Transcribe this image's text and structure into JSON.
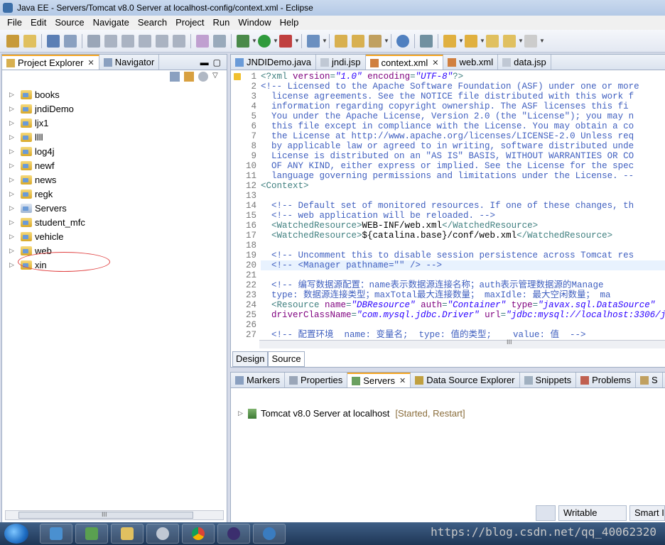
{
  "window": {
    "title": "Java EE - Servers/Tomcat v8.0 Server at localhost-config/context.xml - Eclipse"
  },
  "menu": [
    "File",
    "Edit",
    "Source",
    "Navigate",
    "Search",
    "Project",
    "Run",
    "Window",
    "Help"
  ],
  "left_panel": {
    "tabs": [
      {
        "label": "Project Explorer",
        "active": true,
        "closable": true
      },
      {
        "label": "Navigator",
        "active": false,
        "closable": false
      }
    ],
    "projects": [
      {
        "label": "books"
      },
      {
        "label": "jndiDemo"
      },
      {
        "label": "ljx1"
      },
      {
        "label": "llll"
      },
      {
        "label": "log4j"
      },
      {
        "label": "newf"
      },
      {
        "label": "news"
      },
      {
        "label": "regk"
      },
      {
        "label": "Servers"
      },
      {
        "label": "student_mfc"
      },
      {
        "label": "vehicle"
      },
      {
        "label": "web"
      },
      {
        "label": "xin"
      }
    ],
    "scroll_thumb_label": "III"
  },
  "editor": {
    "tabs": [
      {
        "label": "JNDIDemo.java",
        "active": false
      },
      {
        "label": "jndi.jsp",
        "active": false
      },
      {
        "label": "context.xml",
        "active": true
      },
      {
        "label": "web.xml",
        "active": false
      },
      {
        "label": "data.jsp",
        "active": false
      }
    ],
    "line_numbers": [
      "1",
      "2",
      "3",
      "4",
      "5",
      "6",
      "7",
      "8",
      "9",
      "10",
      "11",
      "12",
      "13",
      "14",
      "15",
      "16",
      "17",
      "18",
      "19",
      "20",
      "21",
      "22",
      "23",
      "24",
      "25",
      "26",
      "27"
    ],
    "current_line": 20,
    "lines": [
      [
        [
          "tag",
          "<?xml "
        ],
        [
          "attr",
          "version"
        ],
        [
          "tag",
          "="
        ],
        [
          "str",
          "\"1.0\""
        ],
        [
          "tag",
          " "
        ],
        [
          "attr",
          "encoding"
        ],
        [
          "tag",
          "="
        ],
        [
          "str",
          "\"UTF-8\""
        ],
        [
          "tag",
          "?>"
        ]
      ],
      [
        [
          "comment",
          "<!-- Licensed to the Apache Software Foundation (ASF) under one or more"
        ]
      ],
      [
        [
          "comment",
          "  license agreements. See the NOTICE file distributed with this work f"
        ]
      ],
      [
        [
          "comment",
          "  information regarding copyright ownership. The ASF licenses this fi"
        ]
      ],
      [
        [
          "comment",
          "  You under the Apache License, Version 2.0 (the \"License\"); you may n"
        ]
      ],
      [
        [
          "comment",
          "  this file except in compliance with the License. You may obtain a co"
        ]
      ],
      [
        [
          "comment",
          "  the License at http://www.apache.org/licenses/LICENSE-2.0 Unless req"
        ]
      ],
      [
        [
          "comment",
          "  by applicable law or agreed to in writing, software distributed unde"
        ]
      ],
      [
        [
          "comment",
          "  License is distributed on an \"AS IS\" BASIS, WITHOUT WARRANTIES OR CO"
        ]
      ],
      [
        [
          "comment",
          "  OF ANY KIND, either express or implied. See the License for the spec"
        ]
      ],
      [
        [
          "comment",
          "  language governing permissions and limitations under the License. --"
        ]
      ],
      [
        [
          "tag",
          "<Context>"
        ]
      ],
      [],
      [
        [
          "comment",
          "  <!-- Default set of monitored resources. If one of these changes, th"
        ]
      ],
      [
        [
          "comment",
          "  <!-- web application will be reloaded. -->"
        ]
      ],
      [
        [
          "tag",
          "  <WatchedResource>"
        ],
        [
          "text",
          "WEB-INF/web.xml"
        ],
        [
          "tag",
          "</WatchedResource>"
        ]
      ],
      [
        [
          "tag",
          "  <WatchedResource>"
        ],
        [
          "text",
          "${catalina.base}/conf/web.xml"
        ],
        [
          "tag",
          "</WatchedResource>"
        ]
      ],
      [],
      [
        [
          "comment",
          "  <!-- Uncomment this to disable session persistence across Tomcat res"
        ]
      ],
      [
        [
          "comment",
          "  <!-- <Manager pathname=\"\" /> -->"
        ]
      ],
      [],
      [
        [
          "comment",
          "  <!-- 编写数据源配置：name表示数据源连接名称；auth表示管理数据源的Manage"
        ]
      ],
      [
        [
          "comment",
          "  type: 数据源连接类型；maxTotal最大连接数量； maxIdle: 最大空闲数量； ma"
        ]
      ],
      [
        [
          "tag",
          "  <Resource "
        ],
        [
          "attr",
          "name"
        ],
        [
          "tag",
          "="
        ],
        [
          "str",
          "\"DBResource\""
        ],
        [
          "tag",
          " "
        ],
        [
          "attr",
          "auth"
        ],
        [
          "tag",
          "="
        ],
        [
          "str",
          "\"Container\""
        ],
        [
          "tag",
          " "
        ],
        [
          "attr",
          "type"
        ],
        [
          "tag",
          "="
        ],
        [
          "str",
          "\"javax.sql.DataSource\""
        ],
        [
          "tag",
          " "
        ]
      ],
      [
        [
          "attr",
          "  driverClassName"
        ],
        [
          "tag",
          "="
        ],
        [
          "str",
          "\"com.mysql.jdbc.Driver\""
        ],
        [
          "tag",
          " "
        ],
        [
          "attr",
          "url"
        ],
        [
          "tag",
          "="
        ],
        [
          "str",
          "\"jdbc:mysql://localhost:3306/j"
        ]
      ],
      [],
      [
        [
          "comment",
          "  <!-- 配置环境  name: 变量名;  type: 值的类型;    value: 值  -->"
        ]
      ]
    ],
    "bottom_tabs": [
      {
        "label": "Design",
        "active": false
      },
      {
        "label": "Source",
        "active": true
      }
    ],
    "scroll_thumb_label": "III"
  },
  "bottom_panel": {
    "tabs": [
      {
        "label": "Markers",
        "active": false
      },
      {
        "label": "Properties",
        "active": false
      },
      {
        "label": "Servers",
        "active": true,
        "closable": true
      },
      {
        "label": "Data Source Explorer",
        "active": false
      },
      {
        "label": "Snippets",
        "active": false
      },
      {
        "label": "Problems",
        "active": false
      },
      {
        "label": "S",
        "active": false
      }
    ],
    "server": {
      "name": "Tomcat v8.0 Server at localhost",
      "status": "[Started, Restart]"
    }
  },
  "status_bar": {
    "writable": "Writable",
    "insert_mode": "Smart I"
  },
  "watermark": "https://blog.csdn.net/qq_40062320",
  "colors": {
    "comment": "#3f5fbf",
    "tag": "#3f7f7f",
    "attr": "#7f007f",
    "string": "#2a00ff",
    "active_tab_accent": "#f5a623"
  }
}
